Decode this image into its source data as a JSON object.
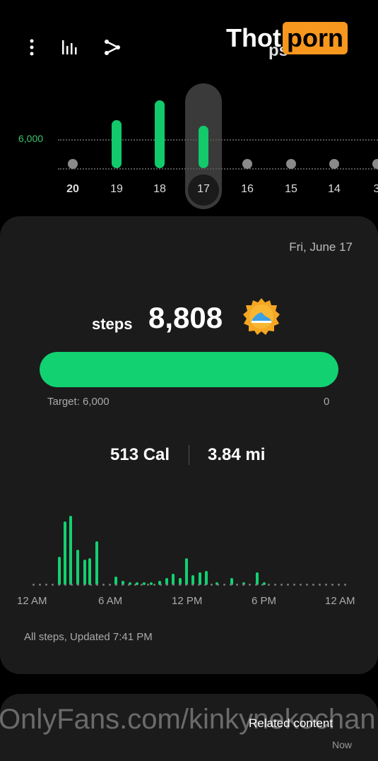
{
  "header": {
    "more_icon": "more-vertical-icon",
    "chart_icon": "bar-chart-icon",
    "share_icon": "share-icon",
    "title_partial": "ps"
  },
  "watermark": {
    "logo_part1": "Thot",
    "logo_part2": "porn",
    "url": "OnlyFans.com/kinkynekochan"
  },
  "week_chart": {
    "goal_label": "6,000",
    "days": [
      {
        "label": "20",
        "steps": 0
      },
      {
        "label": "19",
        "steps": 1
      },
      {
        "label": "18",
        "steps": 1
      },
      {
        "label": "17",
        "steps": 1
      },
      {
        "label": "16",
        "steps": 0
      },
      {
        "label": "15",
        "steps": 0
      },
      {
        "label": "14",
        "steps": 0
      },
      {
        "label": "3",
        "steps": 0
      }
    ],
    "selected_day": "17"
  },
  "summary": {
    "date": "Fri, June 17",
    "steps_value": "8,808",
    "steps_unit": "steps",
    "progress_fraction": 1.0,
    "progress_min": "0",
    "target_label": "Target: 6,000",
    "distance": "3.84 mi",
    "calories": "513 Cal",
    "time_labels": [
      "12 AM",
      "6 AM",
      "12 PM",
      "6 PM",
      "12 AM"
    ],
    "footer": "All steps, Updated 7:41 PM",
    "accent_color": "#12d171"
  },
  "related": {
    "title": "Related content",
    "subtitle": "Now"
  }
}
